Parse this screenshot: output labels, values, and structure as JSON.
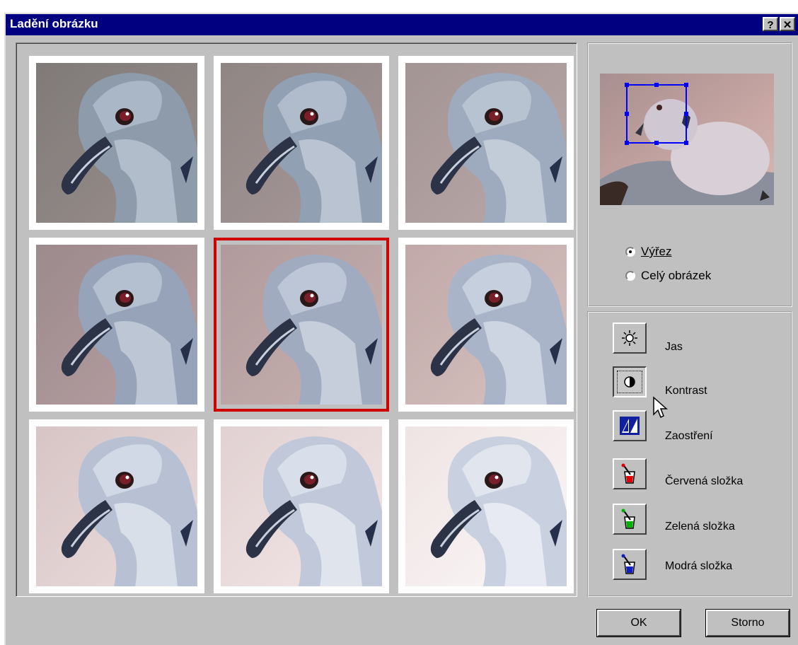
{
  "window": {
    "title": "Ladění obrázku",
    "help_button": "?",
    "close_button": "✕"
  },
  "variations": [
    {
      "id": "v1",
      "tone": "dark-grey"
    },
    {
      "id": "v2",
      "tone": "grey"
    },
    {
      "id": "v3",
      "tone": "light-grey"
    },
    {
      "id": "v4",
      "tone": "mauve"
    },
    {
      "id": "v5",
      "tone": "current",
      "selected": true
    },
    {
      "id": "v6",
      "tone": "pink"
    },
    {
      "id": "v7",
      "tone": "light-pink"
    },
    {
      "id": "v8",
      "tone": "lighter-pink"
    },
    {
      "id": "v9",
      "tone": "washed"
    }
  ],
  "preview": {
    "radio_options": [
      {
        "label": "Výřez",
        "checked": true
      },
      {
        "label": "Celý obrázek",
        "checked": false
      }
    ]
  },
  "tools": [
    {
      "label": "Jas",
      "icon": "sun-icon"
    },
    {
      "label": "Kontrast",
      "icon": "contrast-icon",
      "pressed": true
    },
    {
      "label": "Zaostření",
      "icon": "sharpen-icon"
    },
    {
      "label": "Červená složka",
      "icon": "red-paint-bucket-icon"
    },
    {
      "label": "Zelená složka",
      "icon": "green-paint-bucket-icon"
    },
    {
      "label": "Modrá složka",
      "icon": "blue-paint-bucket-icon"
    }
  ],
  "buttons": {
    "ok": "OK",
    "cancel": "Storno"
  },
  "colors": {
    "title_bar": "#000080",
    "dialog_bg": "#c0c0c0",
    "selection": "#d00000"
  }
}
